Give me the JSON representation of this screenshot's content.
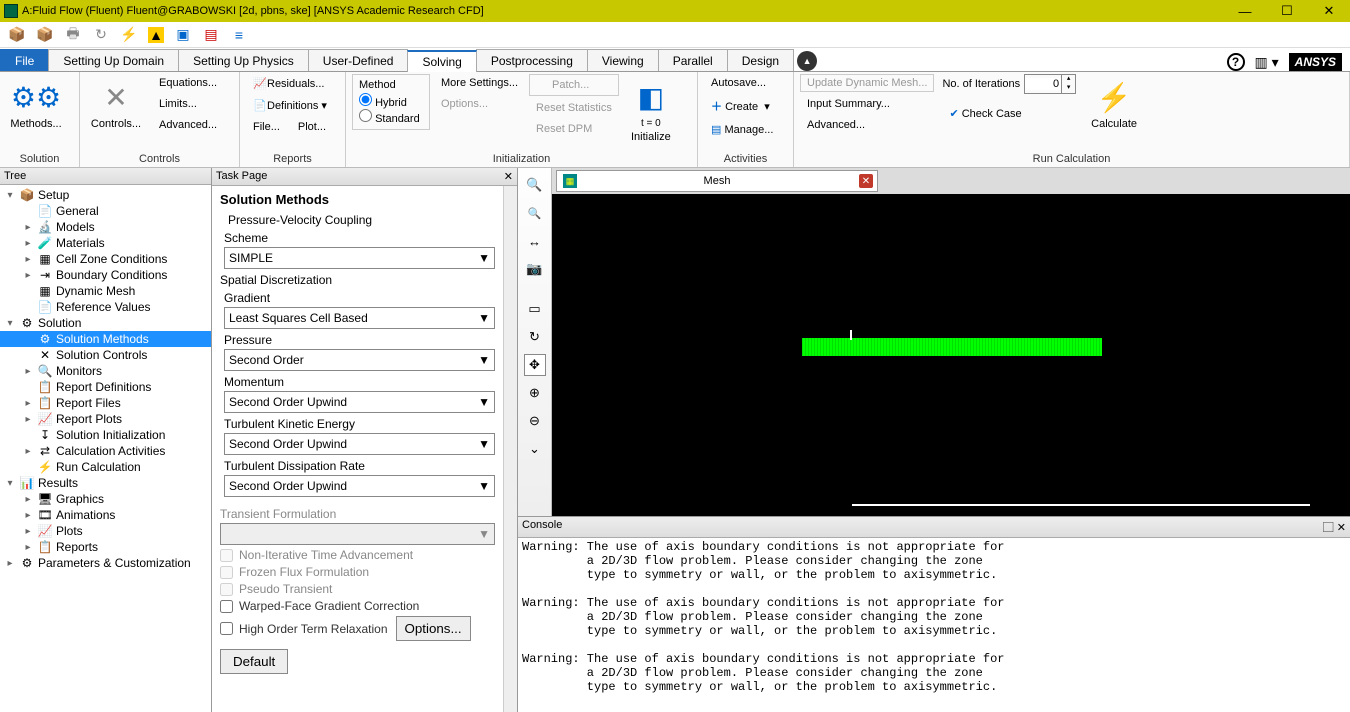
{
  "window": {
    "title": "A:Fluid Flow (Fluent) Fluent@GRABOWSKI [2d, pbns, ske] [ANSYS Academic Research CFD]"
  },
  "tabs": {
    "file": "File",
    "items": [
      "Setting Up Domain",
      "Setting Up Physics",
      "User-Defined",
      "Solving",
      "Postprocessing",
      "Viewing",
      "Parallel",
      "Design"
    ],
    "active": "Solving"
  },
  "ribbon": {
    "solution": {
      "label": "Solution",
      "methods": "Methods...",
      "controls": "Controls...",
      "equations": "Equations...",
      "limits": "Limits...",
      "advanced": "Advanced...",
      "group2": "Controls"
    },
    "reports": {
      "label": "Reports",
      "residuals": "Residuals...",
      "definitions": "Definitions",
      "file": "File...",
      "plot": "Plot..."
    },
    "init": {
      "label": "Initialization",
      "method": "Method",
      "hybrid": "Hybrid",
      "standard": "Standard",
      "more": "More Settings...",
      "options": "Options...",
      "patch": "Patch...",
      "resetstat": "Reset Statistics",
      "resetdpm": "Reset DPM",
      "t0": "t = 0",
      "initialize": "Initialize"
    },
    "activities": {
      "label": "Activities",
      "autosave": "Autosave...",
      "create": "Create",
      "manage": "Manage..."
    },
    "runcalc": {
      "label": "Run Calculation",
      "updatemesh": "Update Dynamic Mesh...",
      "inputsummary": "Input Summary...",
      "advanced": "Advanced...",
      "checkcase": "Check Case",
      "iters_label": "No. of Iterations",
      "iters": "0",
      "calculate": "Calculate"
    }
  },
  "tree_header": "Tree",
  "tree": [
    {
      "ind": 0,
      "tw": "▾",
      "ic": "📦",
      "t": "Setup"
    },
    {
      "ind": 1,
      "tw": "",
      "ic": "📄",
      "t": "General"
    },
    {
      "ind": 1,
      "tw": "▸",
      "ic": "🔬",
      "t": "Models"
    },
    {
      "ind": 1,
      "tw": "▸",
      "ic": "🧪",
      "t": "Materials"
    },
    {
      "ind": 1,
      "tw": "▸",
      "ic": "▦",
      "t": "Cell Zone Conditions"
    },
    {
      "ind": 1,
      "tw": "▸",
      "ic": "⇥",
      "t": "Boundary Conditions"
    },
    {
      "ind": 1,
      "tw": "",
      "ic": "▦",
      "t": "Dynamic Mesh"
    },
    {
      "ind": 1,
      "tw": "",
      "ic": "📄",
      "t": "Reference Values"
    },
    {
      "ind": 0,
      "tw": "▾",
      "ic": "⚙",
      "t": "Solution"
    },
    {
      "ind": 1,
      "tw": "",
      "ic": "⚙",
      "t": "Solution Methods",
      "sel": true
    },
    {
      "ind": 1,
      "tw": "",
      "ic": "✕",
      "t": "Solution Controls"
    },
    {
      "ind": 1,
      "tw": "▸",
      "ic": "🔍",
      "t": "Monitors"
    },
    {
      "ind": 1,
      "tw": "",
      "ic": "📋",
      "t": "Report Definitions"
    },
    {
      "ind": 1,
      "tw": "▸",
      "ic": "📋",
      "t": "Report Files"
    },
    {
      "ind": 1,
      "tw": "▸",
      "ic": "📈",
      "t": "Report Plots"
    },
    {
      "ind": 1,
      "tw": "",
      "ic": "↧",
      "t": "Solution Initialization"
    },
    {
      "ind": 1,
      "tw": "▸",
      "ic": "⇄",
      "t": "Calculation Activities"
    },
    {
      "ind": 1,
      "tw": "",
      "ic": "⚡",
      "t": "Run Calculation"
    },
    {
      "ind": 0,
      "tw": "▾",
      "ic": "📊",
      "t": "Results"
    },
    {
      "ind": 1,
      "tw": "▸",
      "ic": "🖥",
      "t": "Graphics"
    },
    {
      "ind": 1,
      "tw": "▸",
      "ic": "🎞",
      "t": "Animations"
    },
    {
      "ind": 1,
      "tw": "▸",
      "ic": "📈",
      "t": "Plots"
    },
    {
      "ind": 1,
      "tw": "▸",
      "ic": "📋",
      "t": "Reports"
    },
    {
      "ind": 0,
      "tw": "▸",
      "ic": "⚙",
      "t": "Parameters & Customization"
    }
  ],
  "task": {
    "header": "Task Page",
    "title": "Solution Methods",
    "pvc": "Pressure-Velocity Coupling",
    "scheme_label": "Scheme",
    "scheme": "SIMPLE",
    "spatial": "Spatial Discretization",
    "gradient_label": "Gradient",
    "gradient": "Least Squares Cell Based",
    "pressure_label": "Pressure",
    "pressure": "Second Order",
    "momentum_label": "Momentum",
    "momentum": "Second Order Upwind",
    "tke_label": "Turbulent Kinetic Energy",
    "tke": "Second Order Upwind",
    "tdr_label": "Turbulent Dissipation Rate",
    "tdr": "Second Order Upwind",
    "transient": "Transient Formulation",
    "nita": "Non-Iterative Time Advancement",
    "frozen": "Frozen Flux Formulation",
    "pseudo": "Pseudo Transient",
    "warped": "Warped-Face Gradient Correction",
    "highorder": "High Order Term Relaxation",
    "options": "Options...",
    "default": "Default"
  },
  "gfx": {
    "tab": "Mesh"
  },
  "console": {
    "header": "Console",
    "text": "Warning: The use of axis boundary conditions is not appropriate for\n         a 2D/3D flow problem. Please consider changing the zone\n         type to symmetry or wall, or the problem to axisymmetric.\n\nWarning: The use of axis boundary conditions is not appropriate for\n         a 2D/3D flow problem. Please consider changing the zone\n         type to symmetry or wall, or the problem to axisymmetric.\n\nWarning: The use of axis boundary conditions is not appropriate for\n         a 2D/3D flow problem. Please consider changing the zone\n         type to symmetry or wall, or the problem to axisymmetric."
  },
  "brand": "ANSYS"
}
